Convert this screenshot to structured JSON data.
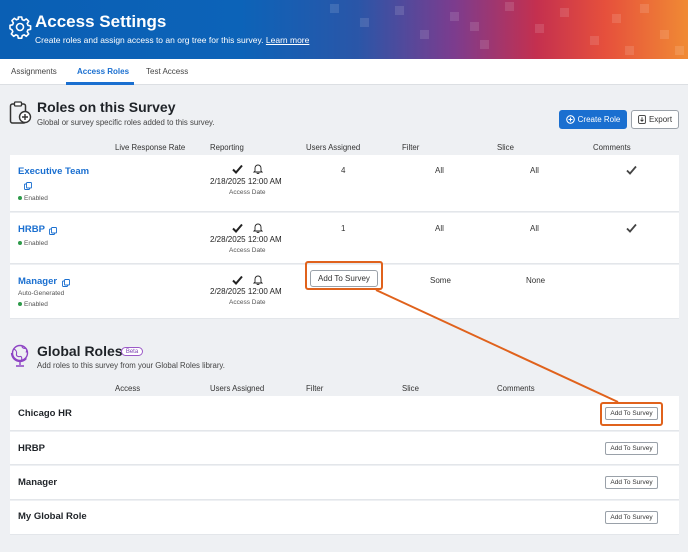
{
  "header": {
    "title": "Access Settings",
    "subtitle": "Create roles and assign access to an org tree for this survey.",
    "learn_more": "Learn more",
    "icon": "gear-icon",
    "gradient_colors": [
      "#0a5fb4",
      "#7c3c8e",
      "#e6503c",
      "#f08a34"
    ]
  },
  "tabs": [
    {
      "label": "Assignments",
      "active": false
    },
    {
      "label": "Access Roles",
      "active": true
    },
    {
      "label": "Test Access",
      "active": false
    }
  ],
  "roles_section": {
    "title": "Roles on this Survey",
    "subtitle": "Global or survey specific roles added to this survey.",
    "icon": "clipboard-add-icon",
    "create_button": "Create Role",
    "export_button": "Export",
    "columns": [
      "Live Response Rate",
      "Reporting",
      "Users Assigned",
      "Filter",
      "Slice",
      "Comments"
    ],
    "rows": [
      {
        "name": "Executive Team",
        "status": "Enabled",
        "note": "",
        "report_date": "2/18/2025 12:00 AM",
        "report_sub": "Access Date",
        "users": "4",
        "filter": "All",
        "slice": "All",
        "comments": true
      },
      {
        "name": "HRBP",
        "status": "Enabled",
        "note": "",
        "report_date": "2/28/2025 12:00 AM",
        "report_sub": "Access Date",
        "users": "1",
        "filter": "All",
        "slice": "All",
        "comments": true
      },
      {
        "name": "Manager",
        "status": "Enabled",
        "note": "Auto-Generated",
        "report_date": "2/28/2025 12:00 AM",
        "report_sub": "Access Date",
        "users_button": "Add To Survey",
        "filter": "Some",
        "slice": "None",
        "comments": false
      }
    ]
  },
  "global_section": {
    "title": "Global Roles",
    "badge": "Beta",
    "subtitle": "Add roles to this survey from your Global Roles library.",
    "icon": "globe-icon",
    "columns": [
      "Access",
      "Users Assigned",
      "Filter",
      "Slice",
      "Comments"
    ],
    "rows": [
      {
        "name": "Chicago HR",
        "button": "Add To Survey"
      },
      {
        "name": "HRBP",
        "button": "Add To Survey"
      },
      {
        "name": "Manager",
        "button": "Add To Survey"
      },
      {
        "name": "My Global Role",
        "button": "Add To Survey"
      }
    ]
  },
  "colors": {
    "accent": "#1a6fd0",
    "highlight": "#e0621c",
    "enabled": "#2e9a4a",
    "beta": "#9b59c7"
  }
}
